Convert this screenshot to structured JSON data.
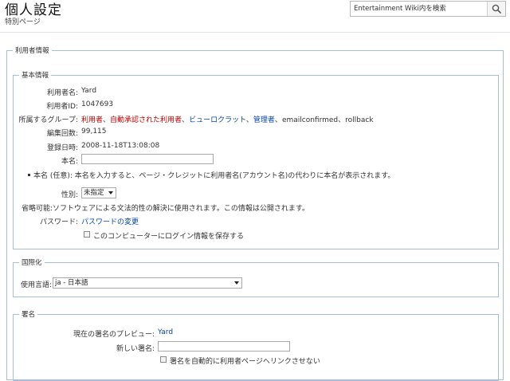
{
  "header": {
    "title": "個人設定",
    "subtitle": "特別ページ",
    "search_placeholder": "Entertainment Wiki内を検索"
  },
  "user_info": {
    "legend": "利用者情報",
    "basic": {
      "legend": "基本情報",
      "username_label": "利用者名:",
      "username_value": "Yard",
      "userid_label": "利用者ID:",
      "userid_value": "1047693",
      "groups_label": "所属するグループ:",
      "groups": [
        {
          "text": "利用者",
          "sep": "、"
        },
        {
          "text": "自動承認された利用者",
          "sep": "、"
        },
        {
          "text": "ビューロクラット",
          "sep": "、"
        },
        {
          "text": "管理者",
          "sep": "、"
        }
      ],
      "groups_rest": "emailconfirmed、rollback",
      "editcount_label": "編集回数:",
      "editcount_value": "99,115",
      "registered_label": "登録日時:",
      "registered_value": "2008-11-18T13:08:08",
      "realname_label": "本名:",
      "realname_note": "本名 (任意): 本名を入力すると、ページ・クレジットに利用者名(アカウント名)の代わりに本名が表示されます。",
      "gender_label": "性別:",
      "gender_value": "未指定",
      "gender_note": "省略可能:ソフトウェアによる文法的性の解決に使用されます。この情報は公開されます。",
      "password_label": "パスワード:",
      "password_link": "パスワードの変更",
      "remember_label": "このコンピューターにログイン情報を保存する"
    },
    "i18n": {
      "legend": "国際化",
      "language_label": "使用言語:",
      "language_value": "ja - 日本語"
    },
    "signature": {
      "legend": "署名",
      "preview_label": "現在の署名のプレビュー:",
      "preview_value": "Yard",
      "new_label": "新しい署名:",
      "nolink_label": "署名を自動的に利用者ページへリンクさせない"
    }
  }
}
